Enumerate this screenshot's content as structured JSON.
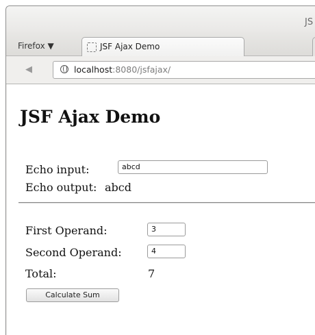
{
  "window": {
    "title_partial": "JS"
  },
  "browser": {
    "menu_label": "Firefox ▼",
    "tab": {
      "label": "JSF Ajax Demo",
      "icon": "blank-page-icon"
    },
    "nav": {
      "back_icon": "back-arrow-icon"
    },
    "url": {
      "host": "localhost",
      "rest": ":8080/jsfajax/",
      "icon": "globe-icon"
    }
  },
  "page": {
    "heading": "JSF Ajax Demo",
    "echo": {
      "input_label": "Echo input:",
      "input_value": "abcd",
      "output_label": "Echo output:",
      "output_value": "abcd"
    },
    "sum": {
      "first_label": "First Operand:",
      "first_value": "3",
      "second_label": "Second Operand:",
      "second_value": "4",
      "total_label": "Total:",
      "total_value": "7",
      "button_label": "Calculate Sum"
    }
  }
}
